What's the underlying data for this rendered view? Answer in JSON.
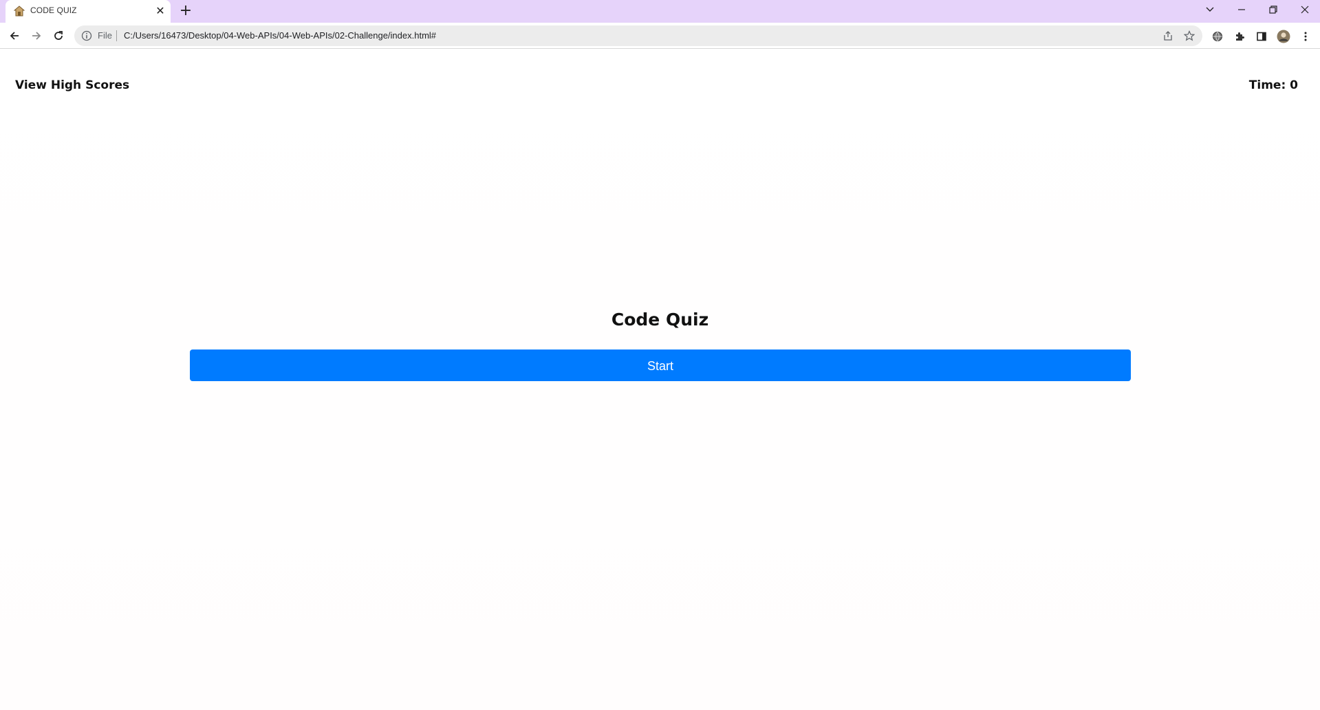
{
  "browser": {
    "tab": {
      "title": "CODE QUIZ",
      "favicon": "house-icon",
      "close_glyph": "✕"
    },
    "new_tab_glyph": "+",
    "address_bar": {
      "scheme_label": "File",
      "url": "C:/Users/16473/Desktop/04-Web-APIs/04-Web-APIs/02-Challenge/index.html#"
    }
  },
  "page": {
    "header": {
      "high_scores_label": "View High Scores",
      "timer_text": "Time: 0"
    },
    "title": "Code Quiz",
    "start_label": "Start"
  },
  "colors": {
    "tab_strip": "#e6d3fa",
    "primary_button": "#007bff"
  }
}
